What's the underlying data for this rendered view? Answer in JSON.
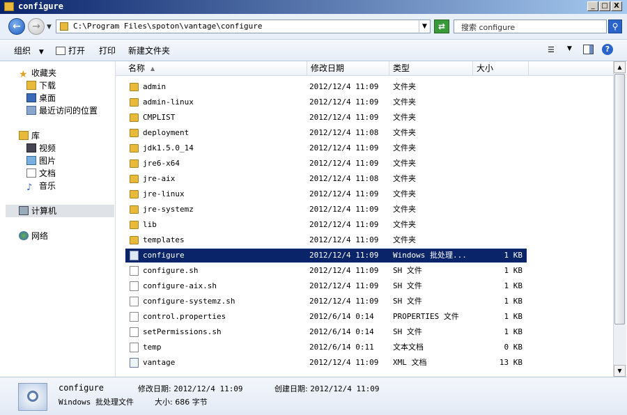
{
  "window": {
    "title": "configure",
    "buttons": {
      "minimize": "_",
      "maximize": "□",
      "close": "X"
    }
  },
  "address": {
    "path": "C:\\Program Files\\spoton\\vantage\\configure",
    "search_placeholder": "搜索 configure"
  },
  "toolbar": {
    "organize": "组织",
    "open": "打开",
    "print": "打印",
    "new_folder": "新建文件夹"
  },
  "nav": {
    "favorites": "收藏夹",
    "downloads": "下载",
    "desktop": "桌面",
    "recent": "最近访问的位置",
    "libraries": "库",
    "videos": "视频",
    "pictures": "图片",
    "documents": "文档",
    "music": "音乐",
    "computer": "计算机",
    "network": "网络"
  },
  "columns": {
    "name": "名称",
    "date": "修改日期",
    "type": "类型",
    "size": "大小"
  },
  "files": [
    {
      "name": "admin",
      "date": "2012/12/4 11:09",
      "type": "文件夹",
      "size": "",
      "icon": "folder-icon"
    },
    {
      "name": "admin-linux",
      "date": "2012/12/4 11:09",
      "type": "文件夹",
      "size": "",
      "icon": "folder-icon"
    },
    {
      "name": "CMPLIST",
      "date": "2012/12/4 11:09",
      "type": "文件夹",
      "size": "",
      "icon": "folder-icon"
    },
    {
      "name": "deployment",
      "date": "2012/12/4 11:08",
      "type": "文件夹",
      "size": "",
      "icon": "folder-icon"
    },
    {
      "name": "jdk1.5.0_14",
      "date": "2012/12/4 11:09",
      "type": "文件夹",
      "size": "",
      "icon": "folder-icon"
    },
    {
      "name": "jre6-x64",
      "date": "2012/12/4 11:09",
      "type": "文件夹",
      "size": "",
      "icon": "folder-icon"
    },
    {
      "name": "jre-aix",
      "date": "2012/12/4 11:08",
      "type": "文件夹",
      "size": "",
      "icon": "folder-icon"
    },
    {
      "name": "jre-linux",
      "date": "2012/12/4 11:09",
      "type": "文件夹",
      "size": "",
      "icon": "folder-icon"
    },
    {
      "name": "jre-systemz",
      "date": "2012/12/4 11:09",
      "type": "文件夹",
      "size": "",
      "icon": "folder-icon"
    },
    {
      "name": "lib",
      "date": "2012/12/4 11:09",
      "type": "文件夹",
      "size": "",
      "icon": "folder-icon"
    },
    {
      "name": "templates",
      "date": "2012/12/4 11:09",
      "type": "文件夹",
      "size": "",
      "icon": "folder-icon"
    },
    {
      "name": "configure",
      "date": "2012/12/4 11:09",
      "type": "Windows 批处理...",
      "size": "1 KB",
      "icon": "batch-file-icon",
      "selected": true
    },
    {
      "name": "configure.sh",
      "date": "2012/12/4 11:09",
      "type": "SH 文件",
      "size": "1 KB",
      "icon": "file-icon"
    },
    {
      "name": "configure-aix.sh",
      "date": "2012/12/4 11:09",
      "type": "SH 文件",
      "size": "1 KB",
      "icon": "file-icon"
    },
    {
      "name": "configure-systemz.sh",
      "date": "2012/12/4 11:09",
      "type": "SH 文件",
      "size": "1 KB",
      "icon": "file-icon"
    },
    {
      "name": "control.properties",
      "date": "2012/6/14 0:14",
      "type": "PROPERTIES 文件",
      "size": "1 KB",
      "icon": "file-icon"
    },
    {
      "name": "setPermissions.sh",
      "date": "2012/6/14 0:14",
      "type": "SH 文件",
      "size": "1 KB",
      "icon": "file-icon"
    },
    {
      "name": "temp",
      "date": "2012/6/14 0:11",
      "type": "文本文档",
      "size": "0 KB",
      "icon": "text-file-icon"
    },
    {
      "name": "vantage",
      "date": "2012/12/4 11:09",
      "type": "XML 文档",
      "size": "13 KB",
      "icon": "xml-file-icon"
    }
  ],
  "details": {
    "name": "configure",
    "kind": "Windows 批处理文件",
    "modified_label": "修改日期:",
    "modified": "2012/12/4 11:09",
    "created_label": "创建日期:",
    "created": "2012/12/4 11:09",
    "size_label": "大小:",
    "size": "686 字节"
  }
}
